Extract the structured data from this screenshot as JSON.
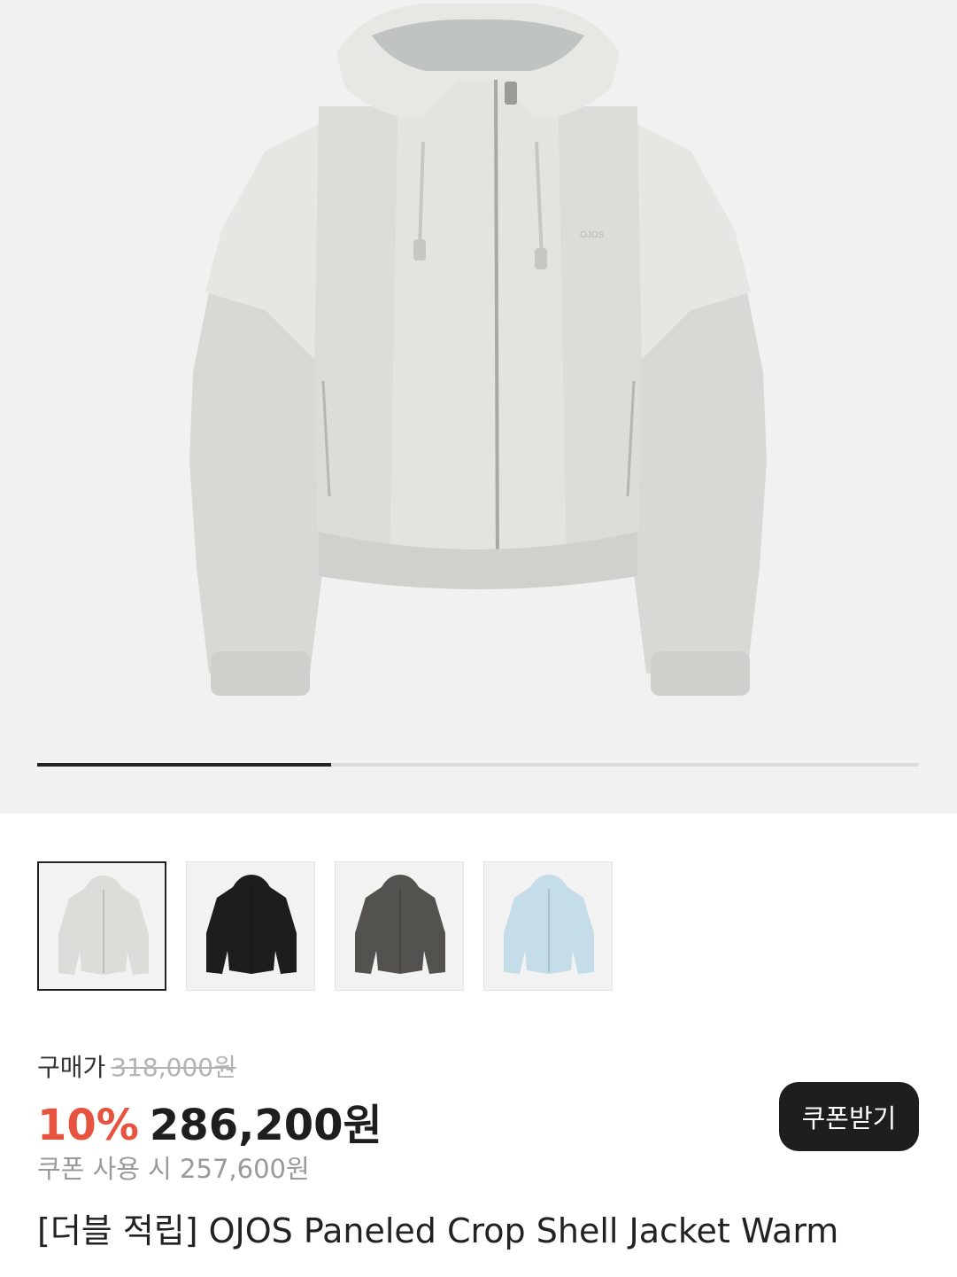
{
  "gallery": {
    "current_index": 1,
    "total": 3,
    "main_image_alt": "light gray paneled crop shell jacket",
    "logo_text": "OJOS"
  },
  "thumbnails": [
    {
      "color_name": "light gray",
      "color": "#dcdcd8",
      "selected": true
    },
    {
      "color_name": "black",
      "color": "#1d1d1d",
      "selected": false
    },
    {
      "color_name": "charcoal",
      "color": "#54524e",
      "selected": false
    },
    {
      "color_name": "sky blue",
      "color": "#c4dde8",
      "selected": false
    }
  ],
  "price": {
    "label": "구매가",
    "original": "318,000원",
    "discount": "10%",
    "current": "286,200원",
    "coupon_text": "쿠폰 사용 시 257,600원",
    "coupon_button": "쿠폰받기",
    "discount_color": "#e8533f"
  },
  "product": {
    "title": "[더블 적립] OJOS Paneled Crop Shell Jacket Warm"
  }
}
